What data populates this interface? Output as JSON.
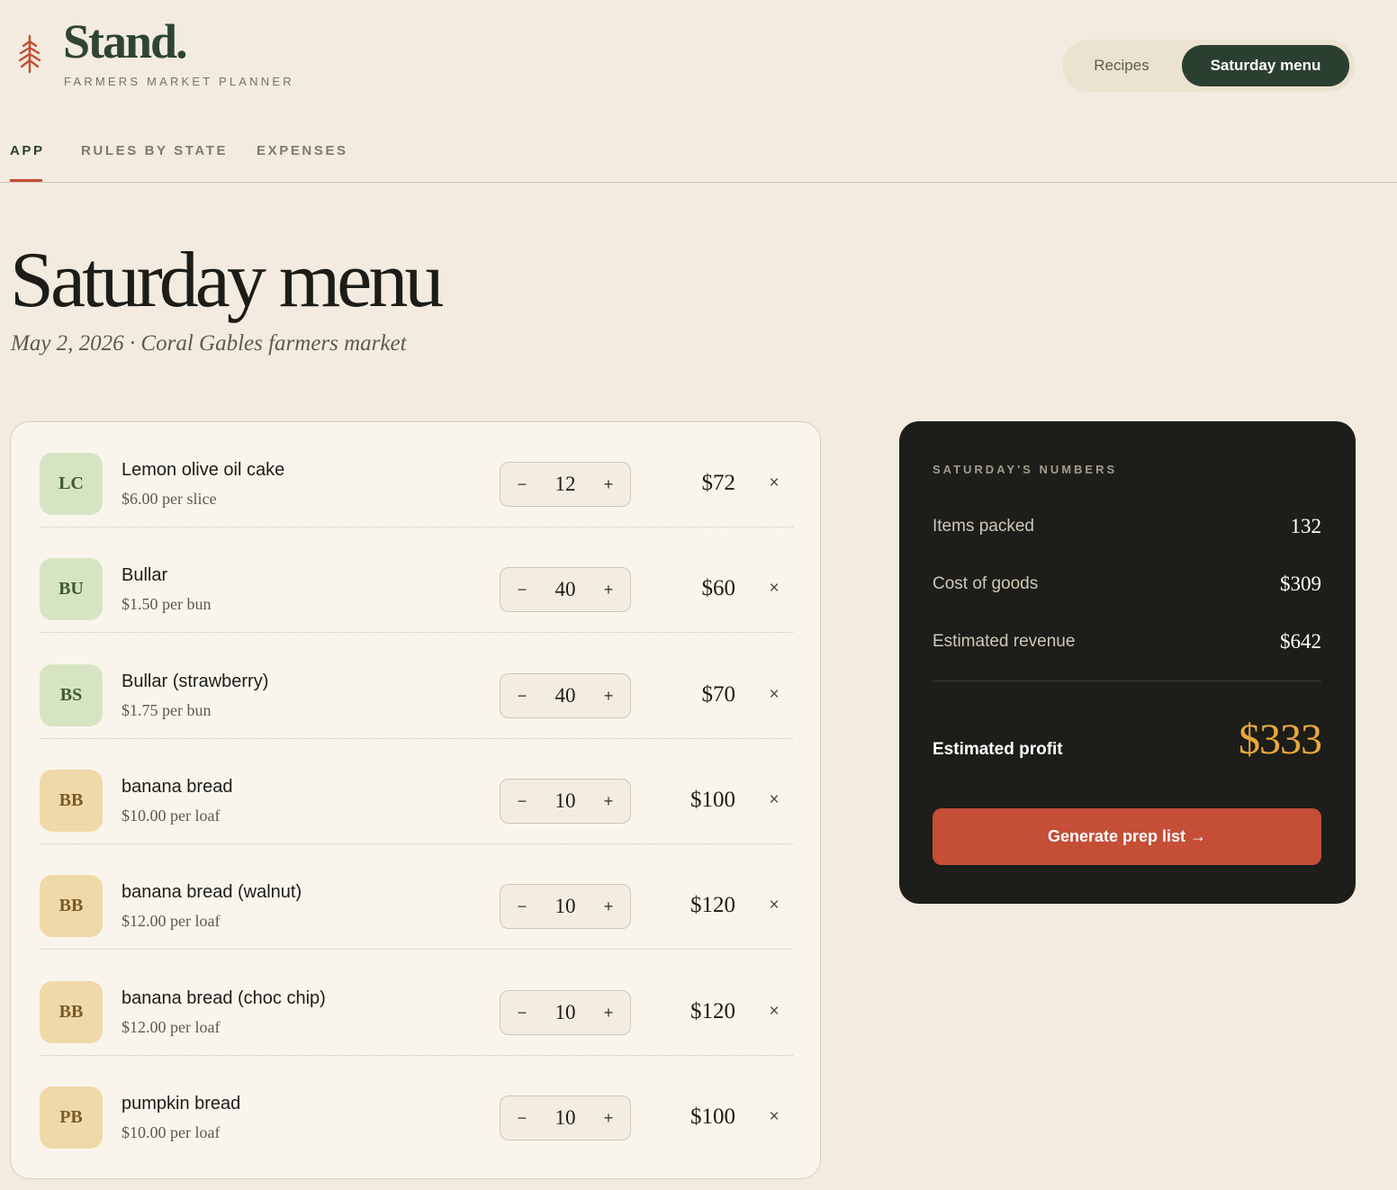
{
  "brand": {
    "name": "Stand.",
    "tagline": "FARMERS MARKET PLANNER",
    "icon": "tree-icon",
    "accent": "#c44e36"
  },
  "view_switch": {
    "recipes_label": "Recipes",
    "saturday_label": "Saturday menu",
    "active": "Saturday menu"
  },
  "tabs": [
    {
      "label": "APP",
      "active": true
    },
    {
      "label": "RULES BY STATE",
      "active": false
    },
    {
      "label": "EXPENSES",
      "active": false
    }
  ],
  "page": {
    "title": "Saturday menu",
    "subtitle": "May 2, 2026 · Coral Gables farmers market"
  },
  "menu_items": [
    {
      "initials": "LC",
      "name": "Lemon olive oil cake",
      "price": "$6.00 per slice",
      "qty": "12",
      "total": "$72",
      "badge_color": "green"
    },
    {
      "initials": "BU",
      "name": "Bullar",
      "price": "$1.50 per bun",
      "qty": "40",
      "total": "$60",
      "badge_color": "green"
    },
    {
      "initials": "BS",
      "name": "Bullar (strawberry)",
      "price": "$1.75 per bun",
      "qty": "40",
      "total": "$70",
      "badge_color": "green"
    },
    {
      "initials": "BB",
      "name": "banana bread",
      "price": "$10.00 per loaf",
      "qty": "10",
      "total": "$100",
      "badge_color": "tan"
    },
    {
      "initials": "BB",
      "name": "banana bread (walnut)",
      "price": "$12.00 per loaf",
      "qty": "10",
      "total": "$120",
      "badge_color": "tan"
    },
    {
      "initials": "BB",
      "name": "banana bread (choc chip)",
      "price": "$12.00 per loaf",
      "qty": "10",
      "total": "$120",
      "badge_color": "tan"
    },
    {
      "initials": "PB",
      "name": "pumpkin bread",
      "price": "$10.00 per loaf",
      "qty": "10",
      "total": "$100",
      "badge_color": "tan"
    }
  ],
  "stepper": {
    "minus": "−",
    "plus": "+"
  },
  "remove_glyph": "×",
  "numbers": {
    "heading": "SATURDAY'S NUMBERS",
    "rows": [
      {
        "label": "Items packed",
        "value": "132"
      },
      {
        "label": "Cost of goods",
        "value": "$309"
      },
      {
        "label": "Estimated revenue",
        "value": "$642"
      }
    ],
    "profit_label": "Estimated profit",
    "profit_value": "$333",
    "button_label": "Generate prep list →"
  }
}
